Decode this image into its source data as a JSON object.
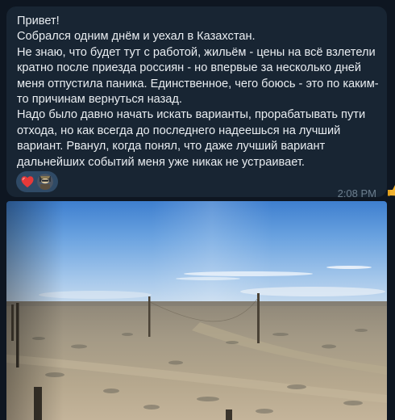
{
  "message": {
    "text": "Привет!\nСобрался одним днём и уехал в Казахстан.\nНе знаю, что будет тут с работой, жильём - цены на всё взлетели кратно после приезда россиян - но впервые за несколько дней меня отпустила паника. Единственное, чего боюсь - это по каким-то причинам вернуться назад.\nНадо было давно начать искать варианты, прорабатывать пути отхода, но как всегда до последнего надеешься на лучший вариант. Рванул, когда понял, что даже лучший вариант дальнейших событий меня уже никак не устраивает.",
    "time": "2:08 PM",
    "reactions": [
      {
        "icon": "heart-icon",
        "color": "#e0303c"
      },
      {
        "icon": "user-avatar",
        "color": "#3a4250"
      }
    ]
  },
  "photo": {
    "description_icon": "steppe-landscape-photo"
  },
  "colors": {
    "background": "#0e1621",
    "bubble": "#182533",
    "text": "#e9edf1",
    "time": "#6d7f8f",
    "reaction_pill": "#2f4a66"
  }
}
